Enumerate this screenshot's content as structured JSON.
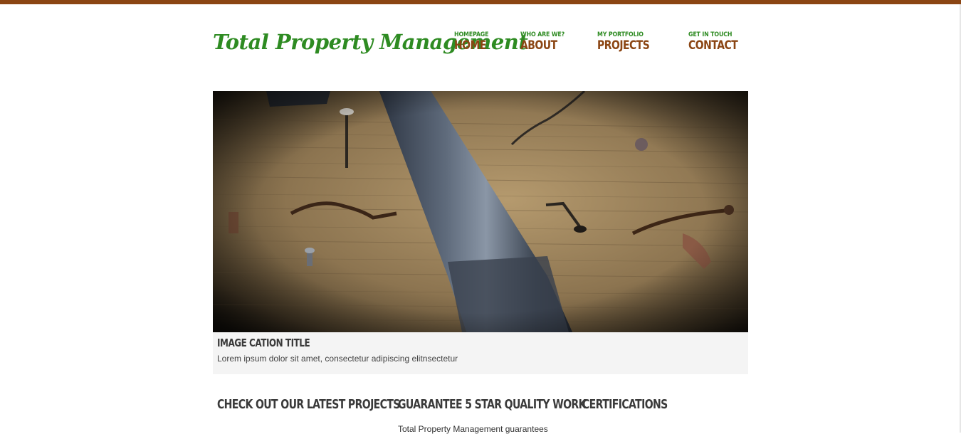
{
  "brand": {
    "logo_text": "Total Property Management",
    "accent_green": "#2e8b22",
    "accent_brown": "#8b4513"
  },
  "nav": {
    "items": [
      {
        "sub": "HOMEPAGE",
        "label": "HOME"
      },
      {
        "sub": "WHO ARE WE?",
        "label": "ABOUT"
      },
      {
        "sub": "MY PORTFOLIO",
        "label": "PROJECTS"
      },
      {
        "sub": "GET IN TOUCH",
        "label": "CONTACT"
      }
    ]
  },
  "hero": {
    "image_description": "hammer-and-nails-photo",
    "caption_title": "IMAGE CATION TITLE",
    "caption_text": "Lorem ipsum dolor sit amet, consectetur adipiscing elitnsectetur"
  },
  "sections": [
    {
      "heading": "CHECK OUT OUR LATEST PROJECTS",
      "text": ""
    },
    {
      "heading": "GUARANTEE 5 STAR QUALITY WORK",
      "text": "Total Property Management guarantees"
    },
    {
      "heading": "CERTIFICATIONS",
      "text": ""
    }
  ]
}
